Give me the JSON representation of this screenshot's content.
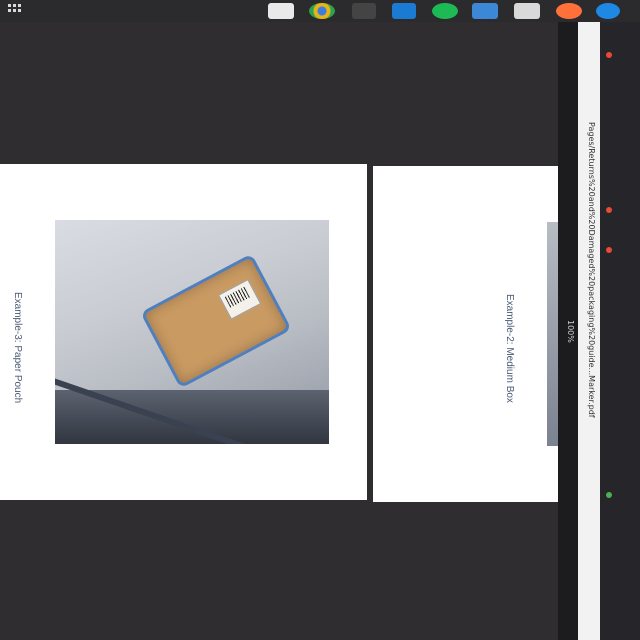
{
  "taskbar": {
    "apps": [
      {
        "name": "gmail-icon",
        "color": "#e9e9e9"
      },
      {
        "name": "chrome-icon",
        "color": "#e7b416"
      },
      {
        "name": "app-icon",
        "color": "#444444"
      },
      {
        "name": "copilot-icon",
        "color": "#1b7ad1"
      },
      {
        "name": "spotify-icon",
        "color": "#1db954"
      },
      {
        "name": "app-icon",
        "color": "#3c87d6"
      },
      {
        "name": "window-icon",
        "color": "#d9d9d9"
      },
      {
        "name": "firefox-icon",
        "color": "#ff7139"
      },
      {
        "name": "edge-icon",
        "color": "#1e88e5"
      }
    ]
  },
  "document": {
    "pages": [
      {
        "caption": "Example-3: Paper Pouch"
      },
      {
        "caption": "Example-2: Medium Box"
      }
    ]
  },
  "browser_panel": {
    "address_text": "Pages/Returns%20and%20Damaged%20packaging%20guide...Marker.pdf",
    "zoom_text": "100%"
  }
}
